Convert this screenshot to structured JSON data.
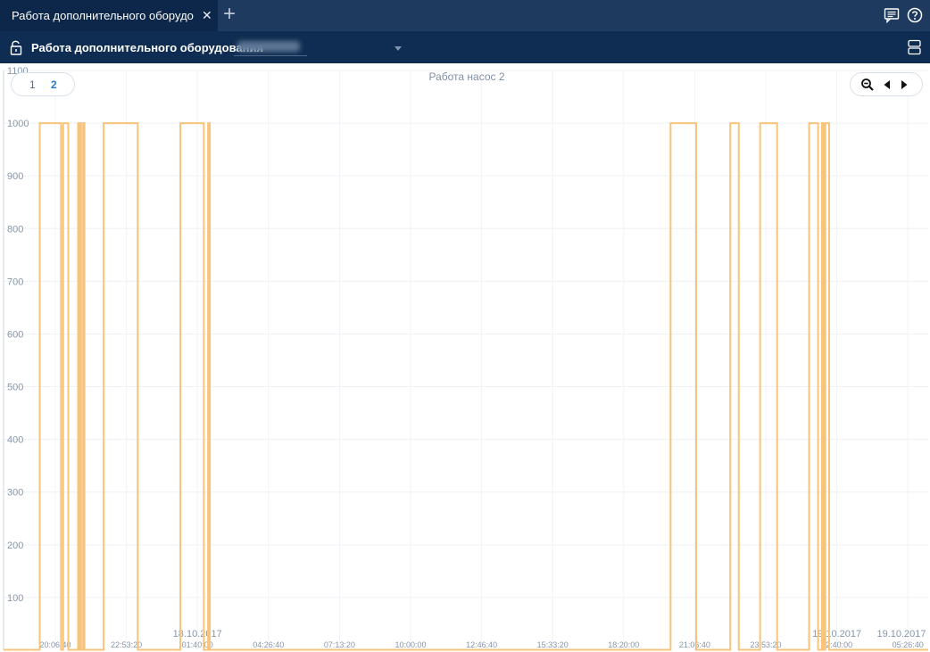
{
  "tabbar": {
    "tab_label": "Работа дополнительного оборудо...",
    "tab_close": "✕",
    "tab_add": "+",
    "icons": [
      "chat-icon",
      "help-icon"
    ]
  },
  "titlebar": {
    "title": "Работа дополнительного оборудования",
    "icons": [
      "unlock-icon",
      "dropdown-icon",
      "layout-icon"
    ]
  },
  "pager": {
    "pages": [
      "1",
      "2"
    ],
    "active": "2"
  },
  "zoom_controls": {
    "icons": [
      "zoom-out-icon",
      "prev-arrow-icon",
      "next-arrow-icon"
    ]
  },
  "chart_data": {
    "type": "line",
    "title": "Работа насос 2",
    "ylim": [
      0,
      1100
    ],
    "yticks": [
      "100",
      "200",
      "300",
      "400",
      "500",
      "600",
      "700",
      "800",
      "900",
      "1000",
      "1100"
    ],
    "xticks": [
      "20:06:40",
      "22:53:20",
      "01:40:00",
      "04:26:40",
      "07:13:20",
      "10:00:00",
      "12:46:40",
      "15:33:20",
      "18:20:00",
      "21:06:40",
      "23:53:20",
      "02:40:00",
      "05:26:40"
    ],
    "date_labels": [
      {
        "label": "18.10.2017",
        "at": "01:40:00"
      },
      {
        "label": "19.10.2017",
        "at": "02:40:00"
      },
      {
        "label": "19.10.2017",
        "at": "05:26:40"
      }
    ],
    "grid": true,
    "series": [
      {
        "color": "#f8c37a",
        "on_intervals": [
          [
            "19:30:00",
            "20:20:00"
          ],
          [
            "20:25:00",
            "20:37:00"
          ],
          [
            "21:00:00",
            "21:03:00"
          ],
          [
            "21:05:00",
            "21:07:00"
          ],
          [
            "21:12:00",
            "21:15:00"
          ],
          [
            "22:00:00",
            "23:20:00"
          ],
          [
            "01:00:00",
            "01:55:00"
          ],
          [
            "02:05:00",
            "02:09:00"
          ],
          [
            "20:10:00",
            "21:10:00"
          ],
          [
            "22:30:00",
            "22:50:00"
          ],
          [
            "23:40:00",
            "00:20:00"
          ],
          [
            "01:35:00",
            "01:56:00"
          ],
          [
            "02:05:00",
            "02:09:00"
          ],
          [
            "02:13:00",
            "02:22:00"
          ]
        ],
        "on_value": 1000,
        "off_value": 0
      }
    ]
  }
}
